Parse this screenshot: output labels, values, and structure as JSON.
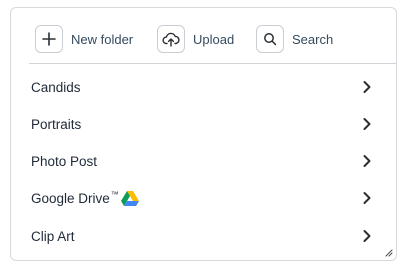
{
  "toolbar": {
    "new_folder": {
      "label": "New folder",
      "icon": "plus-icon"
    },
    "upload": {
      "label": "Upload",
      "icon": "cloud-upload-icon"
    },
    "search": {
      "label": "Search",
      "icon": "search-icon"
    }
  },
  "list": {
    "items": [
      {
        "label": "Candids",
        "icon": "chevron-right-icon"
      },
      {
        "label": "Portraits",
        "icon": "chevron-right-icon"
      },
      {
        "label": "Photo Post",
        "icon": "chevron-right-icon"
      },
      {
        "label": "Google Drive",
        "trademark": "™",
        "badge_icon": "google-drive-icon",
        "icon": "chevron-right-icon"
      },
      {
        "label": "Clip Art",
        "icon": "chevron-right-icon"
      }
    ]
  },
  "colors": {
    "border": "#d6d9dd",
    "text": "#1f2937",
    "toolbar_text": "#344a5e",
    "chevron": "#2b2f33"
  }
}
